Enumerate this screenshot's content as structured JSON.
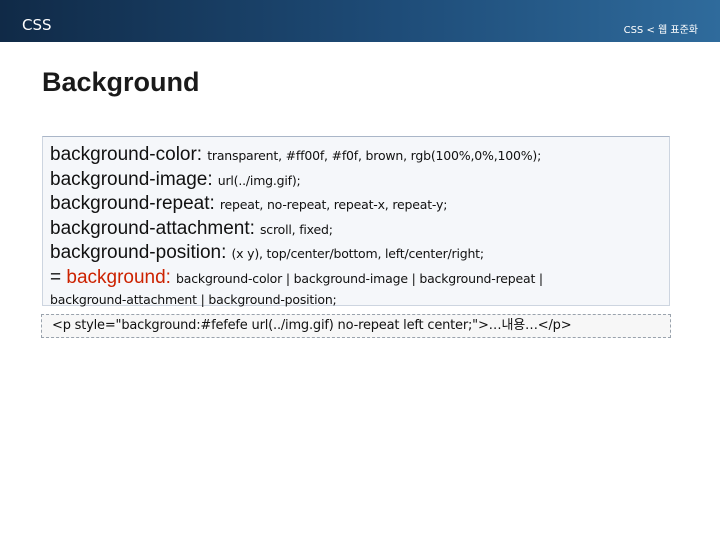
{
  "header": {
    "section_label": "CSS",
    "breadcrumb": "CSS < 웹 표준화"
  },
  "slide": {
    "title": "Background"
  },
  "properties": [
    {
      "name": "background-color:",
      "values": "transparent, #ff00f, #f0f, brown, rgb(100%,0%,100%);"
    },
    {
      "name": "background-image:",
      "values": "url(../img.gif);"
    },
    {
      "name": "background-repeat:",
      "values": "repeat, no-repeat, repeat-x, repeat-y;"
    },
    {
      "name": "background-attachment:",
      "values": "scroll, fixed;"
    },
    {
      "name": "background-position:",
      "values": "(x y), top/center/bottom, left/center/right;"
    }
  ],
  "shorthand": {
    "prefix": "= ",
    "name": "background:",
    "values_line1": "background-color | background-image | background-repeat |",
    "values_line2": "background-attachment | background-position;"
  },
  "example": {
    "code": "<p style=\"background:#fefefe url(../img.gif) no-repeat left center;\">…내용…</p>"
  },
  "colors": {
    "header_gradient_start": "#102a47",
    "header_gradient_end": "#2f6b9c",
    "shorthand_name": "#cc2200",
    "box_background": "#f5f7fa",
    "example_border": "#9aa3ad"
  }
}
